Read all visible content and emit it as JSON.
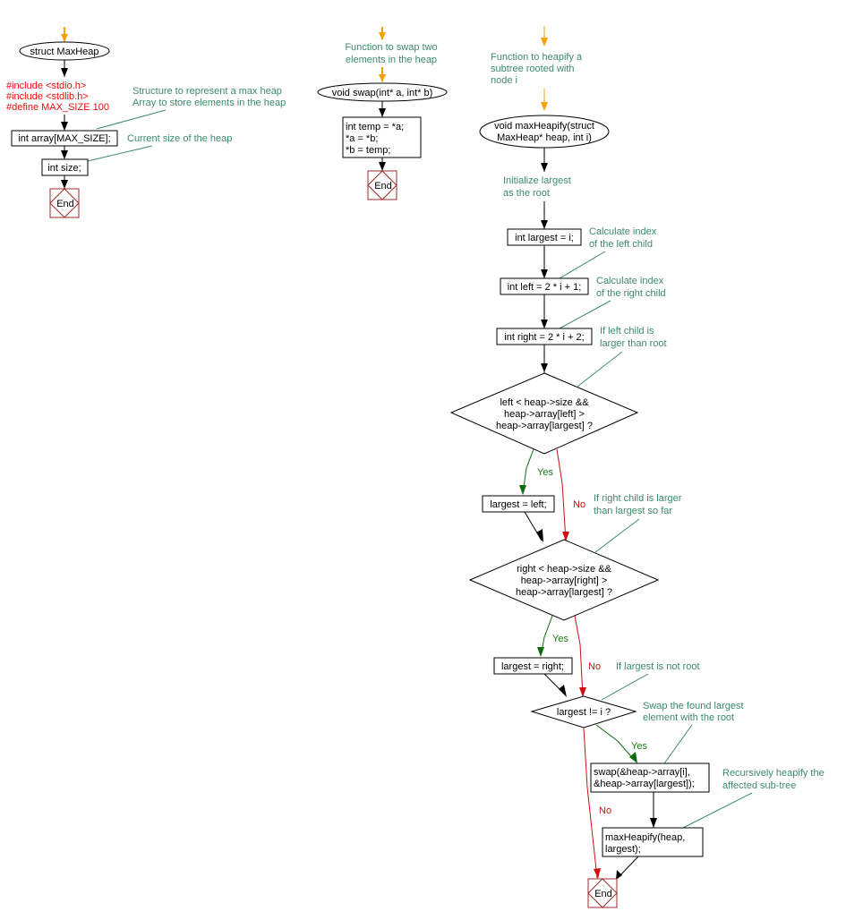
{
  "colors": {
    "start_arrow": "#f5a000",
    "flow": "#000000",
    "yes": "#0e6b0e",
    "no": "#cc1010",
    "comment": "#3d8a6b",
    "preprocessor": "#e8100c",
    "end_border": "#9b2b2b"
  },
  "struct_flow": {
    "start": "struct MaxHeap",
    "preprocessor": [
      "#include <stdio.h>",
      "#include <stdlib.h>",
      "#define MAX_SIZE 100"
    ],
    "comment_struct": [
      "Structure to represent a max heap",
      "Array to store elements in the heap"
    ],
    "array_decl": "int array[MAX_SIZE];",
    "comment_size": "Current size of the heap",
    "size_decl": "int size;",
    "end": "End"
  },
  "swap_flow": {
    "comment": [
      "Function to swap two",
      "elements in the heap"
    ],
    "start": "void swap(int* a, int* b)",
    "body": [
      "int temp = *a;",
      "*a = *b;",
      "*b = temp;"
    ],
    "end": "End"
  },
  "heapify_flow": {
    "comment_func": [
      "Function to heapify a",
      "subtree rooted with",
      "node i"
    ],
    "start": [
      "void maxHeapify(struct",
      "MaxHeap* heap, int i)"
    ],
    "comment_init": [
      "Initialize largest",
      "as the root"
    ],
    "largest_decl": "int largest = i;",
    "comment_left": [
      "Calculate index",
      "of the left child"
    ],
    "left_decl": "int left = 2 * i + 1;",
    "comment_right": [
      "Calculate index",
      "of the right child"
    ],
    "right_decl": "int right = 2 * i + 2;",
    "comment_left_check": [
      "If left child is",
      "larger than root"
    ],
    "left_condition": [
      "left < heap->size &&",
      "heap->array[left] >",
      "heap->array[largest] ?"
    ],
    "yes1": "Yes",
    "no1": "No",
    "assign_left": "largest = left;",
    "comment_right_check": [
      "If right child is larger",
      "than largest so far"
    ],
    "right_condition": [
      "right < heap->size &&",
      "heap->array[right] >",
      "heap->array[largest] ?"
    ],
    "yes2": "Yes",
    "no2": "No",
    "assign_right": "largest = right;",
    "comment_not_root": "If largest is not root",
    "root_condition": "largest != i ?",
    "comment_swap": [
      "Swap the found largest",
      "element with the root"
    ],
    "yes3": "Yes",
    "no3": "No",
    "swap_call": [
      "swap(&heap->array[i],",
      "&heap->array[largest]);"
    ],
    "comment_recurse": [
      "Recursively heapify the",
      "affected sub-tree"
    ],
    "recurse_call": [
      "maxHeapify(heap,",
      "largest);"
    ],
    "end": "End"
  }
}
